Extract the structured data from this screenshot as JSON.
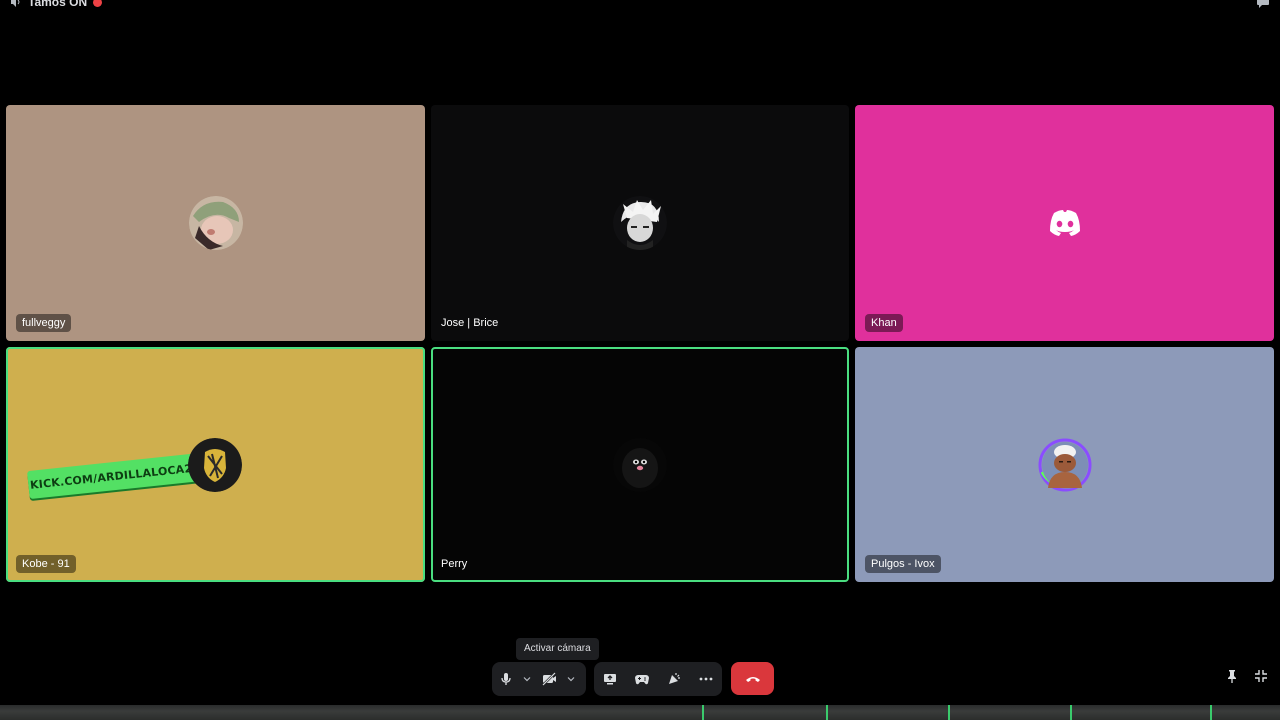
{
  "channel": {
    "name": "Tamos ON"
  },
  "tiles": [
    {
      "name": "fullveggy",
      "bg": "#ae9481"
    },
    {
      "name": "Jose | Brice",
      "bg": "#0b0b0c"
    },
    {
      "name": "Khan",
      "bg": "#e0309c"
    },
    {
      "name": "Kobe - 91",
      "bg": "#cfaf4e",
      "banner": "KICK.COM/ARDILLALOCA24"
    },
    {
      "name": "Perry",
      "bg": "#050505"
    },
    {
      "name": "Pulgos - Ivox",
      "bg": "#8d9ab9"
    }
  ],
  "tooltip": {
    "text": "Activar cámara"
  },
  "colors": {
    "speaking": "#4ade80",
    "end_call": "#da373c",
    "live": "#ed4245"
  },
  "icons": {
    "microphone": "microphone-icon",
    "camera_off": "camera-off-icon",
    "share": "screen-share-icon",
    "activity": "gamepad-icon",
    "soundboard": "soundboard-icon",
    "more": "more-icon",
    "end": "phone-hangup-icon",
    "pin": "pin-icon",
    "collapse": "collapse-icon"
  }
}
